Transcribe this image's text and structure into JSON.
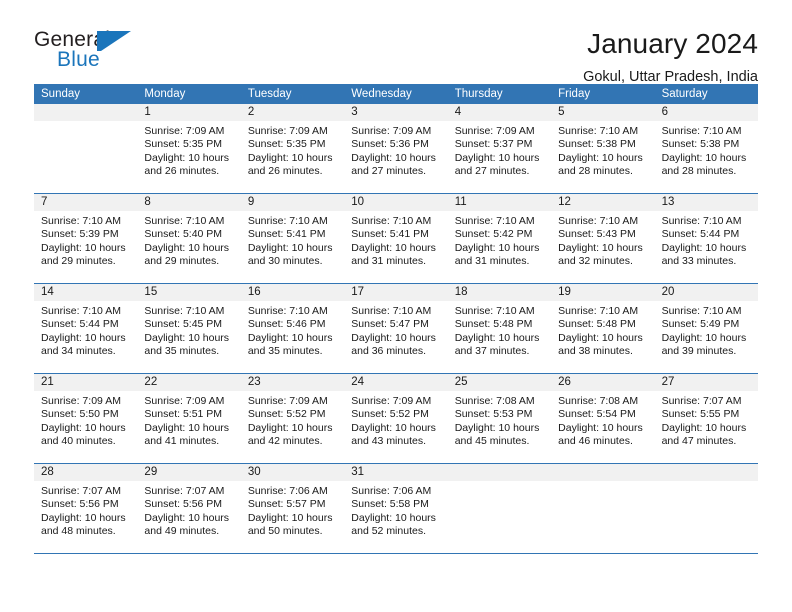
{
  "logo": {
    "word_one": "General",
    "word_two": "Blue",
    "icon": "flag-triangle-icon",
    "brand_color": "#1b75bb"
  },
  "header": {
    "title": "January 2024",
    "subtitle": "Gokul, Uttar Pradesh, India"
  },
  "colors": {
    "header_blue": "#3275b4",
    "day_band_gray": "#f1f1f1",
    "text": "#1a1a1a"
  },
  "calendar": {
    "weekdays": [
      "Sunday",
      "Monday",
      "Tuesday",
      "Wednesday",
      "Thursday",
      "Friday",
      "Saturday"
    ],
    "weeks": [
      [
        {
          "day": "",
          "sunrise": "",
          "sunset": "",
          "daylight": "",
          "empty": true
        },
        {
          "day": "1",
          "sunrise": "Sunrise: 7:09 AM",
          "sunset": "Sunset: 5:35 PM",
          "daylight": "Daylight: 10 hours and 26 minutes."
        },
        {
          "day": "2",
          "sunrise": "Sunrise: 7:09 AM",
          "sunset": "Sunset: 5:35 PM",
          "daylight": "Daylight: 10 hours and 26 minutes."
        },
        {
          "day": "3",
          "sunrise": "Sunrise: 7:09 AM",
          "sunset": "Sunset: 5:36 PM",
          "daylight": "Daylight: 10 hours and 27 minutes."
        },
        {
          "day": "4",
          "sunrise": "Sunrise: 7:09 AM",
          "sunset": "Sunset: 5:37 PM",
          "daylight": "Daylight: 10 hours and 27 minutes."
        },
        {
          "day": "5",
          "sunrise": "Sunrise: 7:10 AM",
          "sunset": "Sunset: 5:38 PM",
          "daylight": "Daylight: 10 hours and 28 minutes."
        },
        {
          "day": "6",
          "sunrise": "Sunrise: 7:10 AM",
          "sunset": "Sunset: 5:38 PM",
          "daylight": "Daylight: 10 hours and 28 minutes."
        }
      ],
      [
        {
          "day": "7",
          "sunrise": "Sunrise: 7:10 AM",
          "sunset": "Sunset: 5:39 PM",
          "daylight": "Daylight: 10 hours and 29 minutes."
        },
        {
          "day": "8",
          "sunrise": "Sunrise: 7:10 AM",
          "sunset": "Sunset: 5:40 PM",
          "daylight": "Daylight: 10 hours and 29 minutes."
        },
        {
          "day": "9",
          "sunrise": "Sunrise: 7:10 AM",
          "sunset": "Sunset: 5:41 PM",
          "daylight": "Daylight: 10 hours and 30 minutes."
        },
        {
          "day": "10",
          "sunrise": "Sunrise: 7:10 AM",
          "sunset": "Sunset: 5:41 PM",
          "daylight": "Daylight: 10 hours and 31 minutes."
        },
        {
          "day": "11",
          "sunrise": "Sunrise: 7:10 AM",
          "sunset": "Sunset: 5:42 PM",
          "daylight": "Daylight: 10 hours and 31 minutes."
        },
        {
          "day": "12",
          "sunrise": "Sunrise: 7:10 AM",
          "sunset": "Sunset: 5:43 PM",
          "daylight": "Daylight: 10 hours and 32 minutes."
        },
        {
          "day": "13",
          "sunrise": "Sunrise: 7:10 AM",
          "sunset": "Sunset: 5:44 PM",
          "daylight": "Daylight: 10 hours and 33 minutes."
        }
      ],
      [
        {
          "day": "14",
          "sunrise": "Sunrise: 7:10 AM",
          "sunset": "Sunset: 5:44 PM",
          "daylight": "Daylight: 10 hours and 34 minutes."
        },
        {
          "day": "15",
          "sunrise": "Sunrise: 7:10 AM",
          "sunset": "Sunset: 5:45 PM",
          "daylight": "Daylight: 10 hours and 35 minutes."
        },
        {
          "day": "16",
          "sunrise": "Sunrise: 7:10 AM",
          "sunset": "Sunset: 5:46 PM",
          "daylight": "Daylight: 10 hours and 35 minutes."
        },
        {
          "day": "17",
          "sunrise": "Sunrise: 7:10 AM",
          "sunset": "Sunset: 5:47 PM",
          "daylight": "Daylight: 10 hours and 36 minutes."
        },
        {
          "day": "18",
          "sunrise": "Sunrise: 7:10 AM",
          "sunset": "Sunset: 5:48 PM",
          "daylight": "Daylight: 10 hours and 37 minutes."
        },
        {
          "day": "19",
          "sunrise": "Sunrise: 7:10 AM",
          "sunset": "Sunset: 5:48 PM",
          "daylight": "Daylight: 10 hours and 38 minutes."
        },
        {
          "day": "20",
          "sunrise": "Sunrise: 7:10 AM",
          "sunset": "Sunset: 5:49 PM",
          "daylight": "Daylight: 10 hours and 39 minutes."
        }
      ],
      [
        {
          "day": "21",
          "sunrise": "Sunrise: 7:09 AM",
          "sunset": "Sunset: 5:50 PM",
          "daylight": "Daylight: 10 hours and 40 minutes."
        },
        {
          "day": "22",
          "sunrise": "Sunrise: 7:09 AM",
          "sunset": "Sunset: 5:51 PM",
          "daylight": "Daylight: 10 hours and 41 minutes."
        },
        {
          "day": "23",
          "sunrise": "Sunrise: 7:09 AM",
          "sunset": "Sunset: 5:52 PM",
          "daylight": "Daylight: 10 hours and 42 minutes."
        },
        {
          "day": "24",
          "sunrise": "Sunrise: 7:09 AM",
          "sunset": "Sunset: 5:52 PM",
          "daylight": "Daylight: 10 hours and 43 minutes."
        },
        {
          "day": "25",
          "sunrise": "Sunrise: 7:08 AM",
          "sunset": "Sunset: 5:53 PM",
          "daylight": "Daylight: 10 hours and 45 minutes."
        },
        {
          "day": "26",
          "sunrise": "Sunrise: 7:08 AM",
          "sunset": "Sunset: 5:54 PM",
          "daylight": "Daylight: 10 hours and 46 minutes."
        },
        {
          "day": "27",
          "sunrise": "Sunrise: 7:07 AM",
          "sunset": "Sunset: 5:55 PM",
          "daylight": "Daylight: 10 hours and 47 minutes."
        }
      ],
      [
        {
          "day": "28",
          "sunrise": "Sunrise: 7:07 AM",
          "sunset": "Sunset: 5:56 PM",
          "daylight": "Daylight: 10 hours and 48 minutes."
        },
        {
          "day": "29",
          "sunrise": "Sunrise: 7:07 AM",
          "sunset": "Sunset: 5:56 PM",
          "daylight": "Daylight: 10 hours and 49 minutes."
        },
        {
          "day": "30",
          "sunrise": "Sunrise: 7:06 AM",
          "sunset": "Sunset: 5:57 PM",
          "daylight": "Daylight: 10 hours and 50 minutes."
        },
        {
          "day": "31",
          "sunrise": "Sunrise: 7:06 AM",
          "sunset": "Sunset: 5:58 PM",
          "daylight": "Daylight: 10 hours and 52 minutes."
        },
        {
          "day": "",
          "sunrise": "",
          "sunset": "",
          "daylight": "",
          "empty": true
        },
        {
          "day": "",
          "sunrise": "",
          "sunset": "",
          "daylight": "",
          "empty": true
        },
        {
          "day": "",
          "sunrise": "",
          "sunset": "",
          "daylight": "",
          "empty": true
        }
      ]
    ]
  }
}
